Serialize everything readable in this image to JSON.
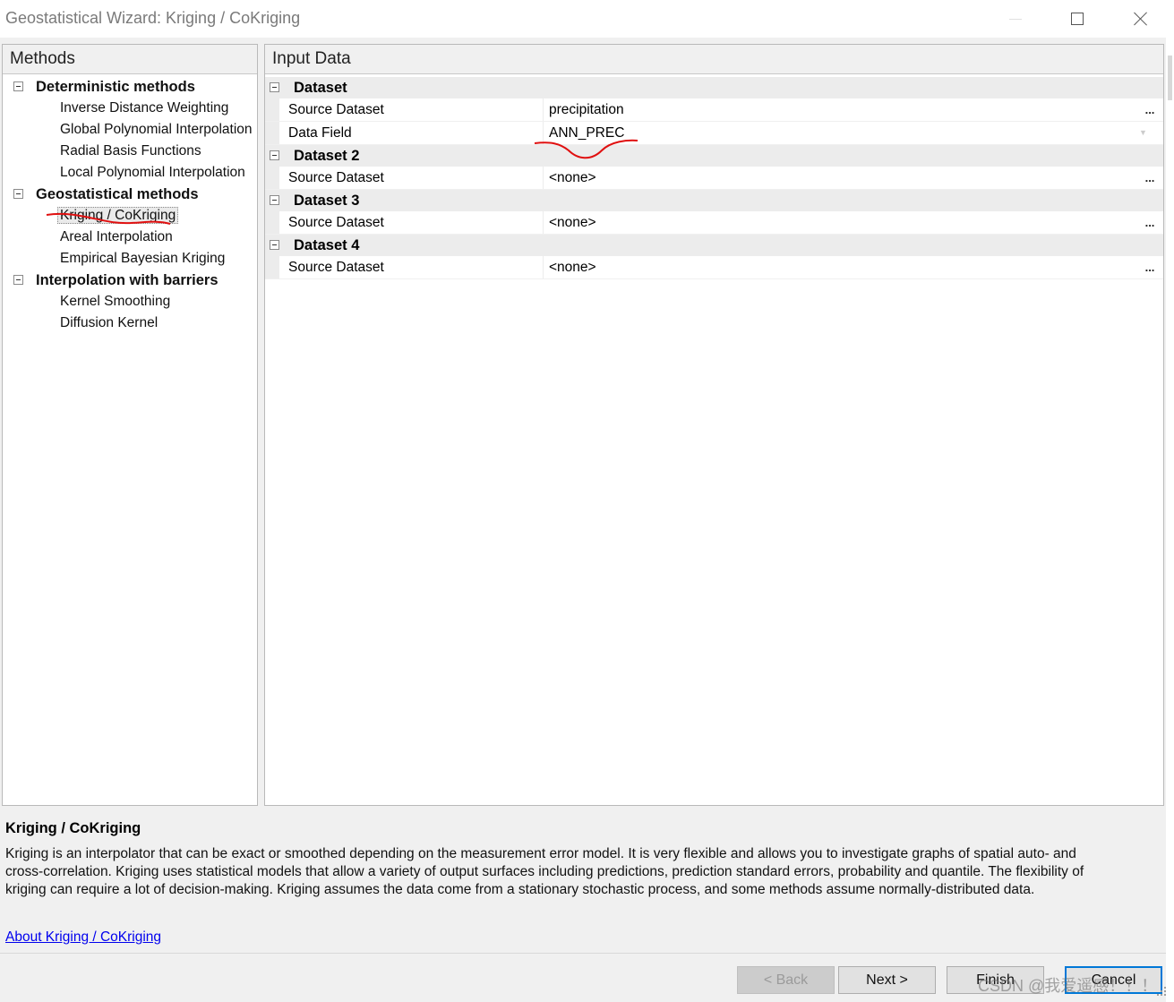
{
  "window": {
    "title": "Geostatistical Wizard: Kriging / CoKriging",
    "controls": [
      "minimize",
      "maximize",
      "close"
    ]
  },
  "methods": {
    "header": "Methods",
    "groups": [
      {
        "label": "Deterministic methods",
        "items": [
          "Inverse Distance Weighting",
          "Global Polynomial Interpolation",
          "Radial Basis Functions",
          "Local Polynomial Interpolation"
        ]
      },
      {
        "label": "Geostatistical methods",
        "items": [
          "Kriging / CoKriging",
          "Areal Interpolation",
          "Empirical Bayesian Kriging"
        ]
      },
      {
        "label": "Interpolation with barriers",
        "items": [
          "Kernel Smoothing",
          "Diffusion Kernel"
        ]
      }
    ],
    "selected": "Kriging / CoKriging"
  },
  "input_data": {
    "header": "Input Data",
    "categories": [
      {
        "label": "Dataset",
        "props": [
          {
            "name": "Source Dataset",
            "value": "precipitation",
            "button": "..."
          },
          {
            "name": "Data Field",
            "value": "ANN_PREC",
            "button": ""
          }
        ]
      },
      {
        "label": "Dataset 2",
        "props": [
          {
            "name": "Source Dataset",
            "value": "<none>",
            "button": "..."
          }
        ]
      },
      {
        "label": "Dataset 3",
        "props": [
          {
            "name": "Source Dataset",
            "value": "<none>",
            "button": "..."
          }
        ]
      },
      {
        "label": "Dataset 4",
        "props": [
          {
            "name": "Source Dataset",
            "value": "<none>",
            "button": "..."
          }
        ]
      }
    ]
  },
  "description": {
    "title": "Kriging / CoKriging",
    "lines": [
      "Kriging is an interpolator that can be exact or smoothed depending on the measurement error model. It is very flexible and allows you to investigate graphs of spatial auto- and",
      "cross-correlation. Kriging uses statistical models that allow a variety of output surfaces including predictions, prediction standard errors, probability and quantile. The flexibility of",
      "kriging can require a lot of decision-making. Kriging assumes the data come from a stationary stochastic process, and some methods assume normally-distributed data."
    ],
    "link": "About Kriging / CoKriging"
  },
  "buttons": {
    "back": "< Back",
    "next": "Next >",
    "finish": "Finish",
    "cancel": "Cancel"
  },
  "watermark": "CSDN @我爱遥感！！！",
  "colors": {
    "background": "#f0f0f0",
    "link": "#0000ee",
    "default_button_border": "#0078d7",
    "annotation": "#e01010"
  }
}
